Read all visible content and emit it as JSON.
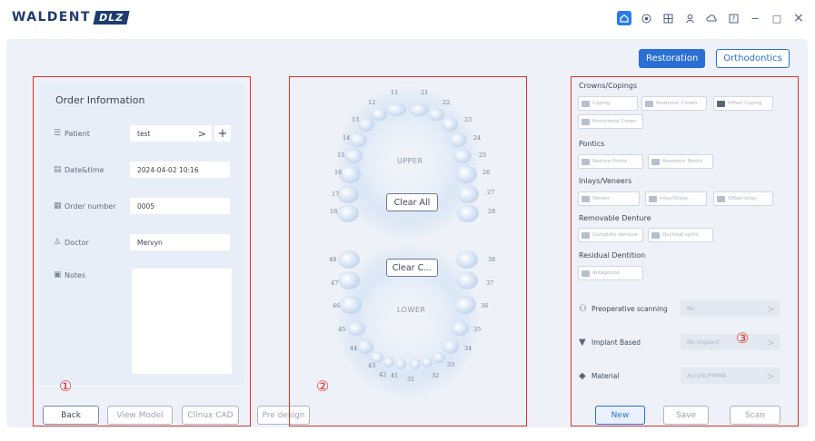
{
  "app": {
    "logo_text": "WALDENT",
    "logo_badge": "DLZ"
  },
  "window_controls": {
    "icons": [
      "home-icon",
      "target-icon",
      "grid-icon",
      "user-icon",
      "cloud-icon",
      "help-icon",
      "minimize-icon",
      "maximize-icon",
      "close-icon"
    ],
    "minimize": "−",
    "maximize": "□",
    "close": "×"
  },
  "mode_tabs": [
    {
      "label": "Restoration",
      "active": true
    },
    {
      "label": "Orthodontics",
      "active": false
    }
  ],
  "annotations": {
    "one": "①",
    "two": "②",
    "three": "③"
  },
  "order": {
    "title": "Order Information",
    "patient_label": "Patient",
    "patient_value": "test",
    "patient_arrow": ">",
    "patient_add": "+",
    "datetime_label": "Date&time",
    "datetime_value": "2024-04-02 10:16",
    "order_number_label": "Order number",
    "order_number_value": "0005",
    "doctor_label": "Doctor",
    "doctor_value": "Mervyn",
    "notes_label": "Notes"
  },
  "bottom_buttons": {
    "back": "Back",
    "view_model": "View Model",
    "clinux_cad": "Clinux CAD",
    "pre_design": "Pre design"
  },
  "teeth": {
    "upper_label": "UPPER",
    "lower_label": "LOWER",
    "clear_all": "Clear All",
    "clear_c": "Clear C...",
    "upper_numbers": [
      "11",
      "12",
      "13",
      "14",
      "15",
      "16",
      "17",
      "18",
      "21",
      "22",
      "23",
      "24",
      "25",
      "26",
      "27",
      "28"
    ],
    "lower_numbers": [
      "31",
      "32",
      "33",
      "34",
      "35",
      "36",
      "37",
      "38",
      "41",
      "42",
      "43",
      "44",
      "45",
      "46",
      "47",
      "48"
    ]
  },
  "products": {
    "crowns_title": "Crowns/Copings",
    "crowns_items": [
      "Coping",
      "Anatomic Crown",
      "Offset Coping",
      "Provisional Crown"
    ],
    "pontics_title": "Pontics",
    "pontics_items": [
      "Reduce Pontic",
      "Anatomic Pontic"
    ],
    "inlays_title": "Inlays/Veneers",
    "inlays_items": [
      "Veneer",
      "Inlay/Onlay",
      "Offset Inlay"
    ],
    "removable_title": "Removable Denture",
    "removable_items": [
      "Complete denture",
      "Occlusal splint"
    ],
    "residual_title": "Residual Dentition",
    "residual_items": [
      "Antagonist"
    ]
  },
  "options": {
    "preop_label": "Preoperative scanning",
    "preop_value": "No",
    "implant_label": "Implant Based",
    "implant_value": "No implant",
    "material_label": "Material",
    "material_value": "Acrylic/PMMA",
    "chevron": ">"
  },
  "actions": {
    "new": "New",
    "save": "Save",
    "scan": "Scan"
  }
}
